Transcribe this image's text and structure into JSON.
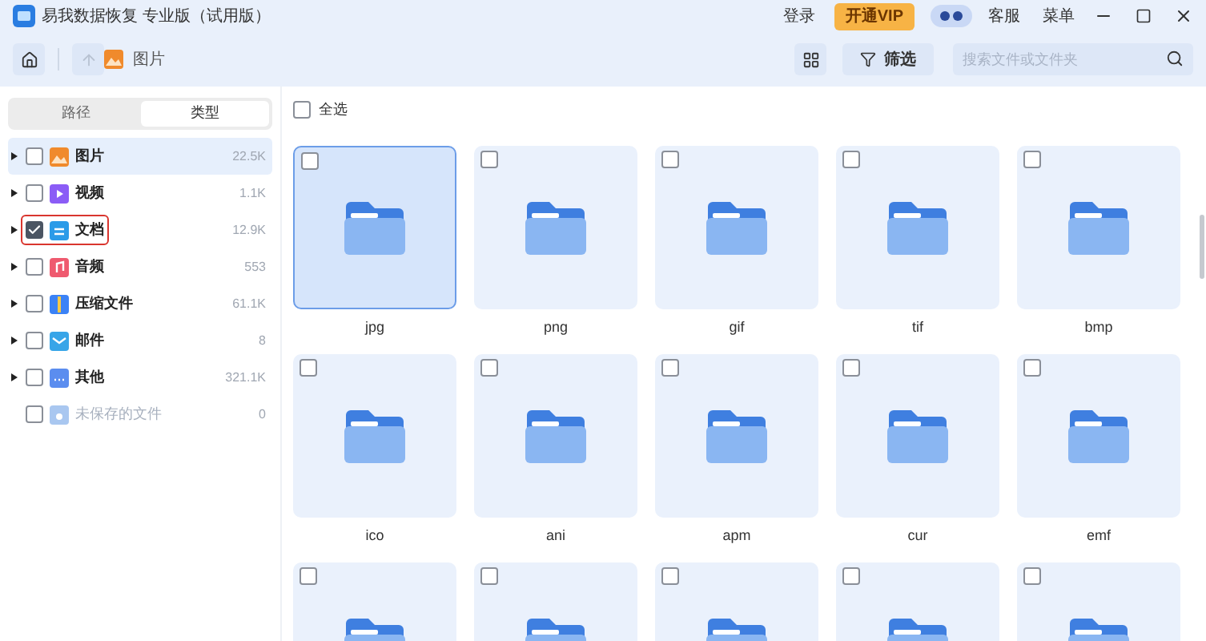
{
  "window": {
    "title": "易我数据恢复 专业版（试用版）",
    "login": "登录",
    "vip": "开通VIP",
    "service": "客服",
    "menu": "菜单"
  },
  "toolbar": {
    "breadcrumb": "图片",
    "filter": "筛选",
    "search": {
      "placeholder": "搜索文件或文件夹"
    }
  },
  "tabs": [
    {
      "label": "路径",
      "selected": false
    },
    {
      "label": "类型",
      "selected": true
    }
  ],
  "sidebar": {
    "items": [
      {
        "label": "图片",
        "count": "22.5K",
        "kind": "image",
        "selected": true,
        "checked": false,
        "highlighted": false,
        "disabled": false
      },
      {
        "label": "视频",
        "count": "1.1K",
        "kind": "video",
        "selected": false,
        "checked": false,
        "highlighted": false,
        "disabled": false
      },
      {
        "label": "文档",
        "count": "12.9K",
        "kind": "document",
        "selected": false,
        "checked": true,
        "highlighted": true,
        "disabled": false
      },
      {
        "label": "音频",
        "count": "553",
        "kind": "audio",
        "selected": false,
        "checked": false,
        "highlighted": false,
        "disabled": false
      },
      {
        "label": "压缩文件",
        "count": "61.1K",
        "kind": "archive",
        "selected": false,
        "checked": false,
        "highlighted": false,
        "disabled": false
      },
      {
        "label": "邮件",
        "count": "8",
        "kind": "mail",
        "selected": false,
        "checked": false,
        "highlighted": false,
        "disabled": false
      },
      {
        "label": "其他",
        "count": "321.1K",
        "kind": "other",
        "selected": false,
        "checked": false,
        "highlighted": false,
        "disabled": false
      },
      {
        "label": "未保存的文件",
        "count": "0",
        "kind": "unsaved",
        "selected": false,
        "checked": false,
        "highlighted": false,
        "disabled": true
      }
    ]
  },
  "select_all": {
    "label": "全选",
    "checked": false
  },
  "folders": [
    {
      "label": "jpg",
      "selected": true,
      "checked": false
    },
    {
      "label": "png",
      "selected": false,
      "checked": false
    },
    {
      "label": "gif",
      "selected": false,
      "checked": false
    },
    {
      "label": "tif",
      "selected": false,
      "checked": false
    },
    {
      "label": "bmp",
      "selected": false,
      "checked": false
    },
    {
      "label": "ico",
      "selected": false,
      "checked": false
    },
    {
      "label": "ani",
      "selected": false,
      "checked": false
    },
    {
      "label": "apm",
      "selected": false,
      "checked": false
    },
    {
      "label": "cur",
      "selected": false,
      "checked": false
    },
    {
      "label": "emf",
      "selected": false,
      "checked": false
    },
    {
      "selected": false,
      "checked": false
    },
    {
      "selected": false,
      "checked": false
    },
    {
      "selected": false,
      "checked": false
    },
    {
      "selected": false,
      "checked": false
    },
    {
      "selected": false,
      "checked": false
    }
  ]
}
